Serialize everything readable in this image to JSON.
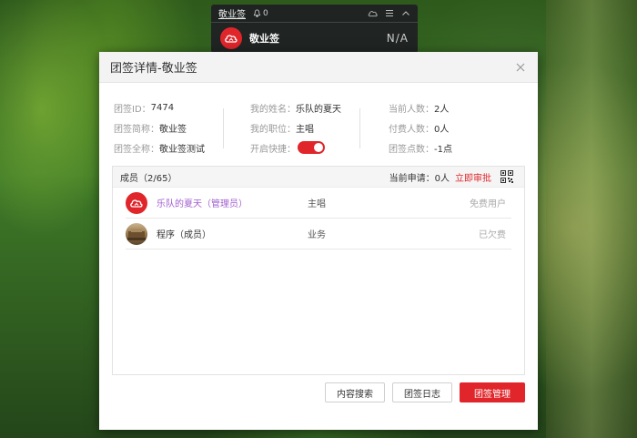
{
  "widget": {
    "title": "敬业签",
    "bell_count": "0",
    "name": "敬业签",
    "status": "N/A"
  },
  "dialog": {
    "title": "团签详情-敬业签"
  },
  "info": {
    "col1": [
      {
        "label": "团签ID：",
        "value": "7474"
      },
      {
        "label": "团签简称：",
        "value": "敬业签"
      },
      {
        "label": "团签全称：",
        "value": "敬业签测试"
      }
    ],
    "col2": [
      {
        "label": "我的姓名：",
        "value": "乐队的夏天"
      },
      {
        "label": "我的职位：",
        "value": "主唱"
      },
      {
        "label": "开启快捷：",
        "value": ""
      }
    ],
    "col3": [
      {
        "label": "当前人数：",
        "value": "2人"
      },
      {
        "label": "付费人数：",
        "value": "0人"
      },
      {
        "label": "团签点数：",
        "value": "-1点"
      }
    ],
    "quick_enabled": true
  },
  "members": {
    "count_label": "成员（2/65）",
    "apply_label": "当前申请：0人",
    "apply_link": "立即审批",
    "rows": [
      {
        "name": "乐队的夏天（管理员）",
        "role": "主唱",
        "status": "免费用户"
      },
      {
        "name": "程序（成员）",
        "role": "业务",
        "status": "已欠费"
      }
    ]
  },
  "buttons": {
    "search": "内容搜索",
    "log": "团签日志",
    "manage": "团签管理"
  },
  "colors": {
    "accent": "#e0262b",
    "admin": "#a25fd0"
  }
}
